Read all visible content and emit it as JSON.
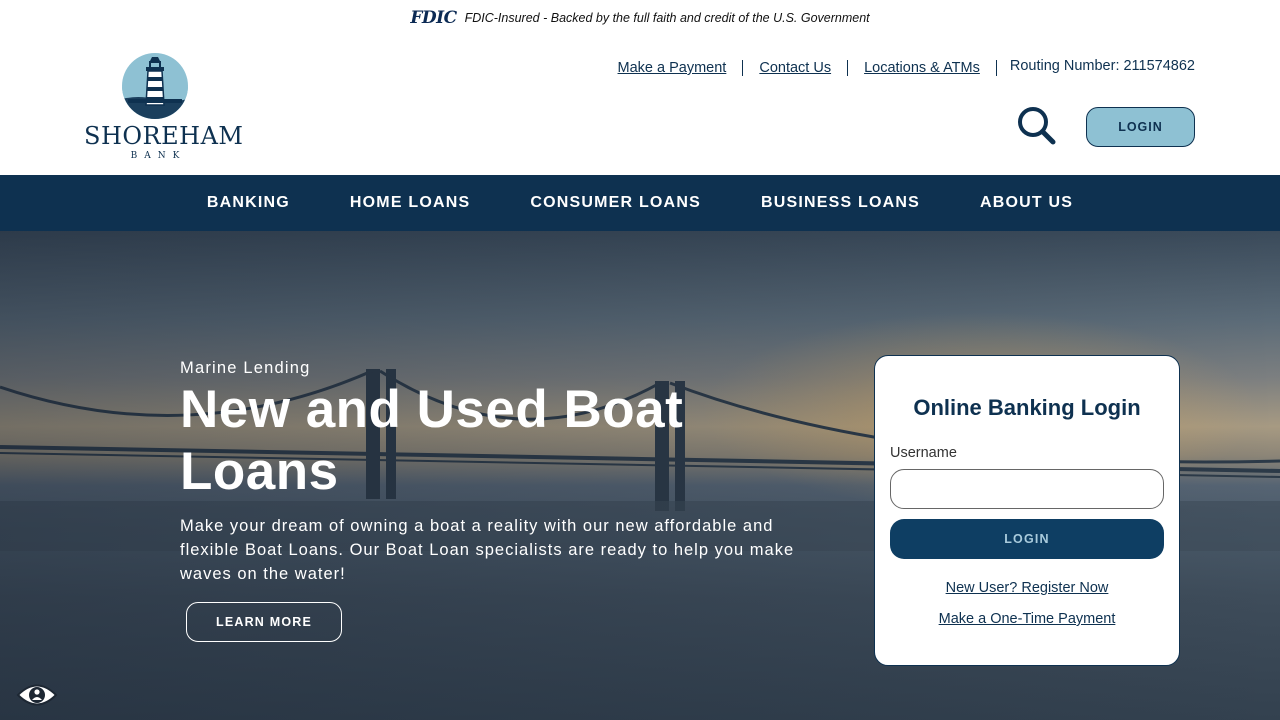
{
  "fdic": {
    "logo": "FDIC",
    "text": "FDIC-Insured - Backed by the full faith and credit of the U.S. Government"
  },
  "header": {
    "logo_name": "SHOREHAM",
    "logo_sub": "BANK",
    "links": {
      "payment": "Make a Payment",
      "contact": "Contact Us",
      "locations": "Locations & ATMs"
    },
    "routing": "Routing Number: 211574862",
    "login_label": "LOGIN"
  },
  "nav": {
    "banking": "BANKING",
    "home_loans": "HOME LOANS",
    "consumer_loans": "CONSUMER LOANS",
    "business_loans": "BUSINESS LOANS",
    "about_us": "ABOUT US"
  },
  "hero": {
    "kicker": "Marine Lending",
    "title": "New and Used Boat Loans",
    "description": "Make your dream of owning a boat a reality with our new affordable and flexible Boat Loans. Our Boat Loan specialists are ready to help you make waves on the water!",
    "cta": "LEARN MORE"
  },
  "login_card": {
    "title": "Online Banking Login",
    "username_label": "Username",
    "username_value": "",
    "login_label": "LOGIN",
    "register_link": "New User? Register Now",
    "payment_link": "Make a One-Time Payment"
  },
  "colors": {
    "brand_navy": "#0e3150",
    "brand_light_blue": "#8ec1d3"
  },
  "icons": {
    "search": "search-icon",
    "accessibility": "eye-icon",
    "logo": "lighthouse-icon"
  }
}
